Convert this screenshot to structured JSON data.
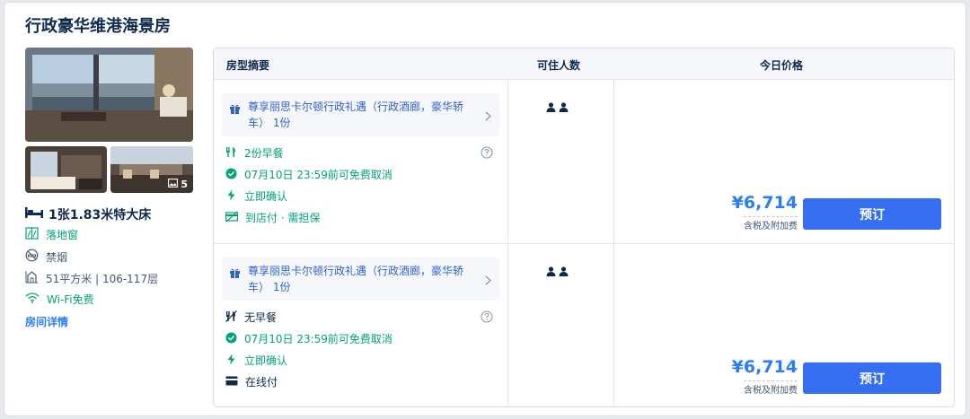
{
  "room": {
    "title": "行政豪华维港海景房",
    "photo_count": "5",
    "bed": "1张1.83米特大床",
    "features": [
      {
        "icon": "window-icon",
        "label": "落地窗"
      },
      {
        "icon": "no-smoking-icon",
        "label": "禁烟"
      },
      {
        "icon": "room-size-icon",
        "label": "51平方米 | 106-117层"
      },
      {
        "icon": "wifi-icon",
        "label": "Wi-Fi免费"
      }
    ],
    "detail_link": "房间详情"
  },
  "table": {
    "headers": [
      "房型摘要",
      "可住人数",
      "今日价格"
    ]
  },
  "offers": [
    {
      "perk": "尊享丽思卡尔顿行政礼遇（行政酒廊，豪华轿车） 1份",
      "meal": "2份早餐",
      "cancel": "07月10日 23:59前可免费取消",
      "confirm": "立即确认",
      "payment": "到店付 · 需担保",
      "price": "¥6,714",
      "price_note": "含税及附加费",
      "book": "预订"
    },
    {
      "perk": "尊享丽思卡尔顿行政礼遇（行政酒廊，豪华轿车） 1份",
      "meal": "无早餐",
      "cancel": "07月10日 23:59前可免费取消",
      "confirm": "立即确认",
      "payment": "在线付",
      "price": "¥6,714",
      "price_note": "含税及附加费",
      "book": "预订"
    }
  ],
  "colors": {
    "accent": "#287dfa",
    "button": "#356ef0",
    "green": "#00a37a",
    "text": "#0f294d"
  }
}
